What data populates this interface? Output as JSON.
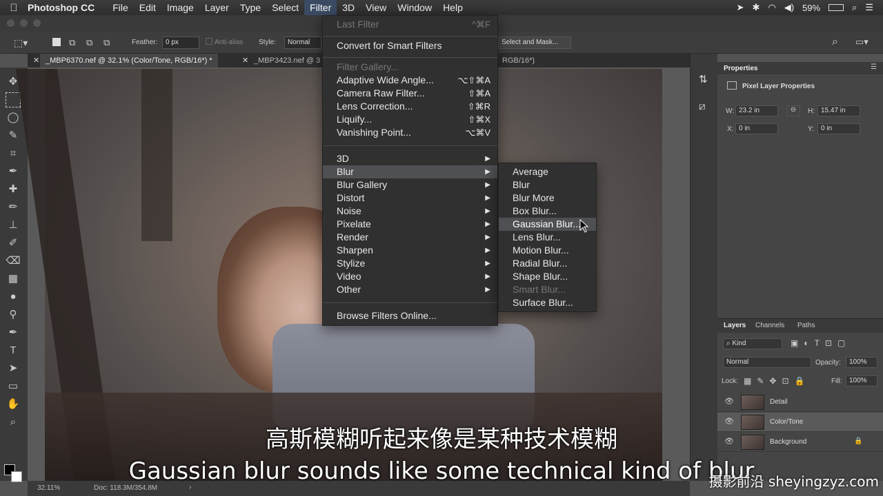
{
  "menubar": {
    "apple": "",
    "app": "Photoshop CC",
    "items": [
      "File",
      "Edit",
      "Image",
      "Layer",
      "Type",
      "Select",
      "Filter",
      "3D",
      "View",
      "Window",
      "Help"
    ],
    "battery": "59%"
  },
  "options": {
    "feather_label": "Feather:",
    "feather_value": "0 px",
    "antialias": "Anti-alias",
    "style_label": "Style:",
    "style_value": "Normal",
    "select_mask": "Select and Mask..."
  },
  "tabs": [
    "_MBP6370.nef @ 32.1% (Color/Tone, RGB/16*) *",
    "_MBP3423.nef @ 3"
  ],
  "tab_tail": "RGB/16*)",
  "filter_menu": {
    "last_filter": "Last Filter",
    "last_filter_sc": "^⌘F",
    "convert": "Convert for Smart Filters",
    "filter_gallery": "Filter Gallery...",
    "adaptive": "Adaptive Wide Angle...",
    "adaptive_sc": "⌥⇧⌘A",
    "camera_raw": "Camera Raw Filter...",
    "camera_raw_sc": "⇧⌘A",
    "lens_correction": "Lens Correction...",
    "lens_correction_sc": "⇧⌘R",
    "liquify": "Liquify...",
    "liquify_sc": "⇧⌘X",
    "vanishing": "Vanishing Point...",
    "vanishing_sc": "⌥⌘V",
    "sub_items": [
      "3D",
      "Blur",
      "Blur Gallery",
      "Distort",
      "Noise",
      "Pixelate",
      "Render",
      "Sharpen",
      "Stylize",
      "Video",
      "Other"
    ],
    "browse": "Browse Filters Online..."
  },
  "blur_menu": {
    "items": [
      "Average",
      "Blur",
      "Blur More",
      "Box Blur...",
      "Gaussian Blur...",
      "Lens Blur...",
      "Motion Blur...",
      "Radial Blur...",
      "Shape Blur...",
      "Smart Blur...",
      "Surface Blur..."
    ]
  },
  "properties": {
    "title": "Properties",
    "subtitle": "Pixel Layer Properties",
    "w_label": "W:",
    "w_value": "23.2 in",
    "h_label": "H:",
    "h_value": "15.47 in",
    "x_label": "X:",
    "x_value": "0 in",
    "y_label": "Y:",
    "y_value": "0 in"
  },
  "layers": {
    "tabs": [
      "Layers",
      "Channels",
      "Paths"
    ],
    "kind": "Kind",
    "blend": "Normal",
    "opacity_label": "Opacity:",
    "opacity_value": "100%",
    "lock_label": "Lock:",
    "fill_label": "Fill:",
    "fill_value": "100%",
    "rows": [
      "Detail",
      "Color/Tone",
      "Background"
    ]
  },
  "status": {
    "zoom": "32.11%",
    "doc": "Doc: 118.3M/354.8M"
  },
  "subtitles": {
    "zh": "高斯模糊听起来像是某种技术模糊",
    "en": "Gaussian blur sounds like some technical kind of blur"
  },
  "watermark": "摄影前沿 sheyingzyz.com"
}
